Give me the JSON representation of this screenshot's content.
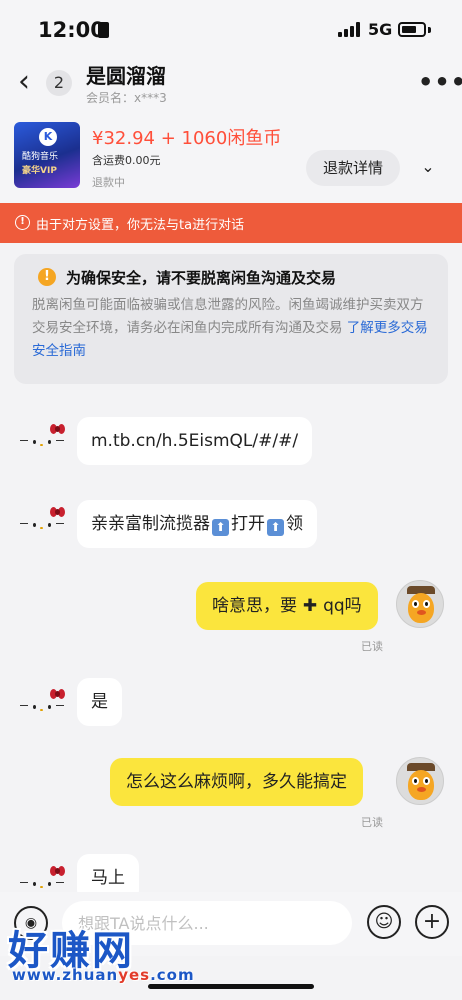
{
  "status_bar": {
    "time": "12:00",
    "network": "5G"
  },
  "header": {
    "back_count": "2",
    "title": "是圆溜溜",
    "subtitle": "会员名：x***3"
  },
  "product": {
    "thumb_brand": "酷狗音乐",
    "thumb_vip": "豪华VIP",
    "price": "¥32.94 + 1060闲鱼币",
    "shipping": "含运费0.00元",
    "state": "退款中",
    "refund_button": "退款详情"
  },
  "notice": {
    "text": "由于对方设置，你无法与ta进行对话"
  },
  "safety": {
    "heading": "为确保安全，请不要脱离闲鱼沟通及交易",
    "body": "脱离闲鱼可能面临被骗或信息泄露的风险。闲鱼竭诚维护买卖双方交易安全环境，请务必在闲鱼内完成所有沟通及交易",
    "link": "了解更多交易安全指南"
  },
  "messages": [
    {
      "side": "in",
      "text": "m.tb.cn/h.5EismQL/#/#/"
    },
    {
      "side": "in",
      "text_a": "亲亲富制流揽器",
      "text_b": "打开",
      "text_c": "领"
    },
    {
      "side": "out",
      "text_a": "啥意思，要",
      "text_b": "qq吗",
      "read": "已读"
    },
    {
      "side": "in",
      "text": "是"
    },
    {
      "side": "out",
      "text": "怎么这么麻烦啊，多久能搞定",
      "read": "已读"
    },
    {
      "side": "in",
      "text": "马上"
    }
  ],
  "input": {
    "placeholder": "想跟TA说点什么..."
  },
  "watermark": {
    "big": "好赚网",
    "url_a": "www.zhuan",
    "url_b": "yes",
    "url_c": ".com"
  },
  "icons": [
    "back-chevron-icon",
    "more-dots-icon",
    "chevron-down-icon",
    "info-icon",
    "warning-icon",
    "upload-arrow-icon",
    "voice-icon",
    "emoji-icon",
    "add-icon"
  ],
  "colors": {
    "accent_orange": "#ee5b3b",
    "price_red": "#ff4f3a",
    "bubble_yellow": "#fbe53d",
    "link_blue": "#2a6ad6"
  }
}
